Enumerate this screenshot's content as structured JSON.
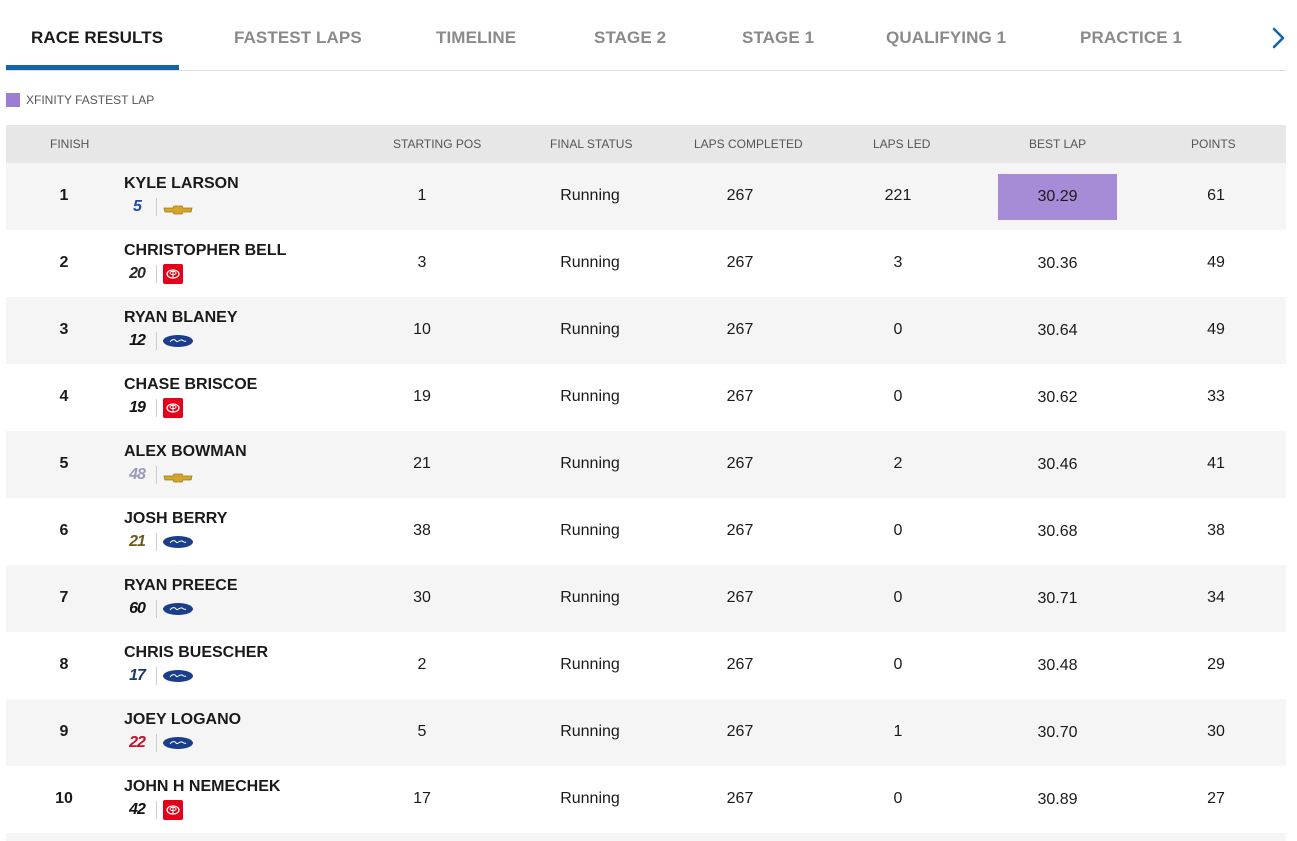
{
  "tabs": [
    {
      "label": "RACE RESULTS",
      "active": true
    },
    {
      "label": "FASTEST LAPS",
      "active": false
    },
    {
      "label": "TIMELINE",
      "active": false
    },
    {
      "label": "STAGE 2",
      "active": false
    },
    {
      "label": "STAGE 1",
      "active": false
    },
    {
      "label": "QUALIFYING 1",
      "active": false
    },
    {
      "label": "PRACTICE 1",
      "active": false
    }
  ],
  "tabs_next_icon": "chevron-right-icon",
  "legend": {
    "label": "XFINITY FASTEST LAP",
    "color": "#9b7dd4"
  },
  "table": {
    "headers": {
      "finish": "FINISH",
      "starting_pos": "STARTING POS",
      "final_status": "FINAL STATUS",
      "laps_completed": "LAPS COMPLETED",
      "laps_led": "LAPS LED",
      "best_lap": "BEST LAP",
      "points": "POINTS"
    },
    "rows": [
      {
        "finish": "1",
        "driver": "KYLE LARSON",
        "car_number": "5",
        "car_color": "#1f4aa8",
        "make": "chevrolet",
        "starting_pos": "1",
        "final_status": "Running",
        "laps_completed": "267",
        "laps_led": "221",
        "best_lap": "30.29",
        "fastest": true,
        "points": "61"
      },
      {
        "finish": "2",
        "driver": "CHRISTOPHER BELL",
        "car_number": "20",
        "car_color": "#2a2a2a",
        "make": "toyota",
        "starting_pos": "3",
        "final_status": "Running",
        "laps_completed": "267",
        "laps_led": "3",
        "best_lap": "30.36",
        "fastest": false,
        "points": "49"
      },
      {
        "finish": "3",
        "driver": "RYAN BLANEY",
        "car_number": "12",
        "car_color": "#111111",
        "make": "ford",
        "starting_pos": "10",
        "final_status": "Running",
        "laps_completed": "267",
        "laps_led": "0",
        "best_lap": "30.64",
        "fastest": false,
        "points": "49"
      },
      {
        "finish": "4",
        "driver": "CHASE BRISCOE",
        "car_number": "19",
        "car_color": "#111111",
        "make": "toyota",
        "starting_pos": "19",
        "final_status": "Running",
        "laps_completed": "267",
        "laps_led": "0",
        "best_lap": "30.62",
        "fastest": false,
        "points": "33"
      },
      {
        "finish": "5",
        "driver": "ALEX BOWMAN",
        "car_number": "48",
        "car_color": "#9a9ab8",
        "make": "chevrolet",
        "starting_pos": "21",
        "final_status": "Running",
        "laps_completed": "267",
        "laps_led": "2",
        "best_lap": "30.46",
        "fastest": false,
        "points": "41"
      },
      {
        "finish": "6",
        "driver": "JOSH BERRY",
        "car_number": "21",
        "car_color": "#6b5a1e",
        "make": "ford",
        "starting_pos": "38",
        "final_status": "Running",
        "laps_completed": "267",
        "laps_led": "0",
        "best_lap": "30.68",
        "fastest": false,
        "points": "38"
      },
      {
        "finish": "7",
        "driver": "RYAN PREECE",
        "car_number": "60",
        "car_color": "#111111",
        "make": "ford",
        "starting_pos": "30",
        "final_status": "Running",
        "laps_completed": "267",
        "laps_led": "0",
        "best_lap": "30.71",
        "fastest": false,
        "points": "34"
      },
      {
        "finish": "8",
        "driver": "CHRIS BUESCHER",
        "car_number": "17",
        "car_color": "#1b3a6b",
        "make": "ford",
        "starting_pos": "2",
        "final_status": "Running",
        "laps_completed": "267",
        "laps_led": "0",
        "best_lap": "30.48",
        "fastest": false,
        "points": "29"
      },
      {
        "finish": "9",
        "driver": "JOEY LOGANO",
        "car_number": "22",
        "car_color": "#c8102e",
        "make": "ford",
        "starting_pos": "5",
        "final_status": "Running",
        "laps_completed": "267",
        "laps_led": "1",
        "best_lap": "30.70",
        "fastest": false,
        "points": "30"
      },
      {
        "finish": "10",
        "driver": "JOHN H NEMECHEK",
        "car_number": "42",
        "car_color": "#111111",
        "make": "toyota",
        "starting_pos": "17",
        "final_status": "Running",
        "laps_completed": "267",
        "laps_led": "0",
        "best_lap": "30.89",
        "fastest": false,
        "points": "27"
      }
    ]
  }
}
